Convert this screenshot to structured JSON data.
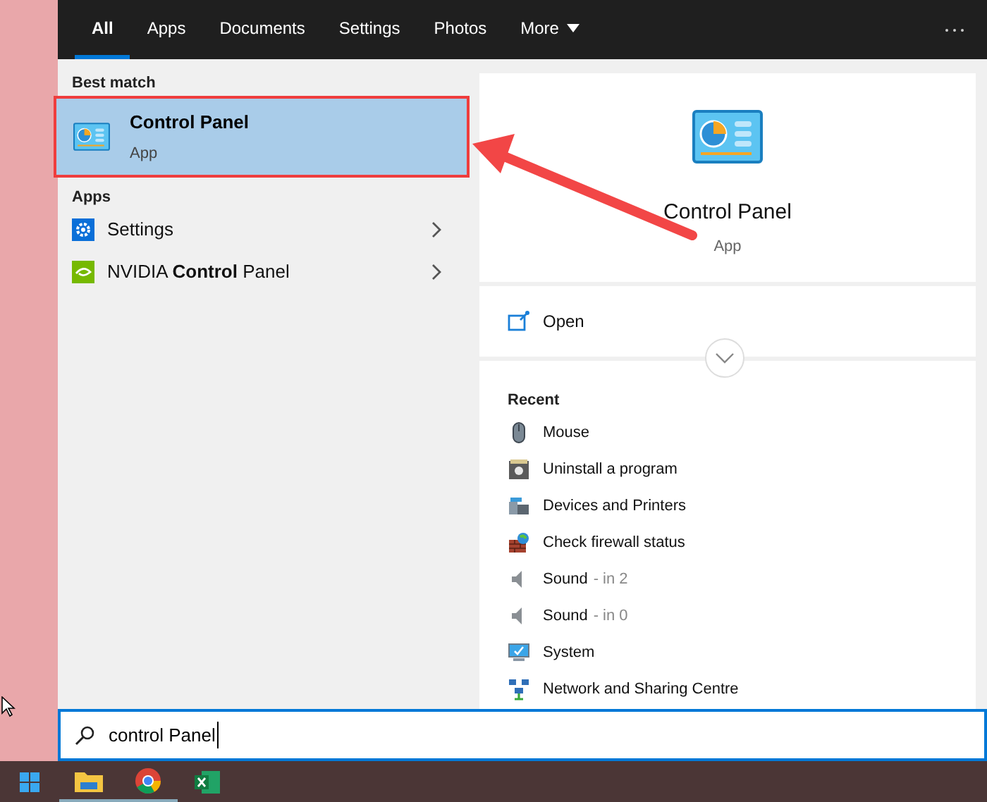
{
  "tabs": [
    {
      "label": "All",
      "selected": true,
      "kind": "tab"
    },
    {
      "label": "Apps",
      "selected": false,
      "kind": "tab"
    },
    {
      "label": "Documents",
      "selected": false,
      "kind": "tab"
    },
    {
      "label": "Settings",
      "selected": false,
      "kind": "tab"
    },
    {
      "label": "Photos",
      "selected": false,
      "kind": "tab"
    },
    {
      "label": "More",
      "selected": false,
      "kind": "dropdown"
    }
  ],
  "results": {
    "best_match_heading": "Best match",
    "best_match": {
      "title": "Control Panel",
      "subtitle": "App",
      "selected": true,
      "annotated": true
    },
    "apps_heading": "Apps",
    "apps": [
      {
        "label": "Settings",
        "kind": "settings"
      },
      {
        "label": "NVIDIA **Control** Panel",
        "kind": "nvidia"
      }
    ]
  },
  "preview": {
    "title": "Control Panel",
    "subtitle": "App",
    "actions": [
      {
        "label": "Open",
        "kind": "open"
      }
    ],
    "recent_heading": "Recent",
    "recent": [
      {
        "label": "Mouse",
        "kind": "mouse"
      },
      {
        "label": "Uninstall a program",
        "kind": "programs"
      },
      {
        "label": "Devices and Printers",
        "kind": "devices"
      },
      {
        "label": "Check firewall status",
        "kind": "firewall"
      },
      {
        "label": "Sound",
        "location": "- in 2",
        "kind": "sound"
      },
      {
        "label": "Sound",
        "location": "- in 0",
        "kind": "sound"
      },
      {
        "label": "System",
        "kind": "system"
      },
      {
        "label": "Network and Sharing Centre",
        "kind": "network"
      }
    ]
  },
  "search": {
    "value": "control Panel"
  }
}
